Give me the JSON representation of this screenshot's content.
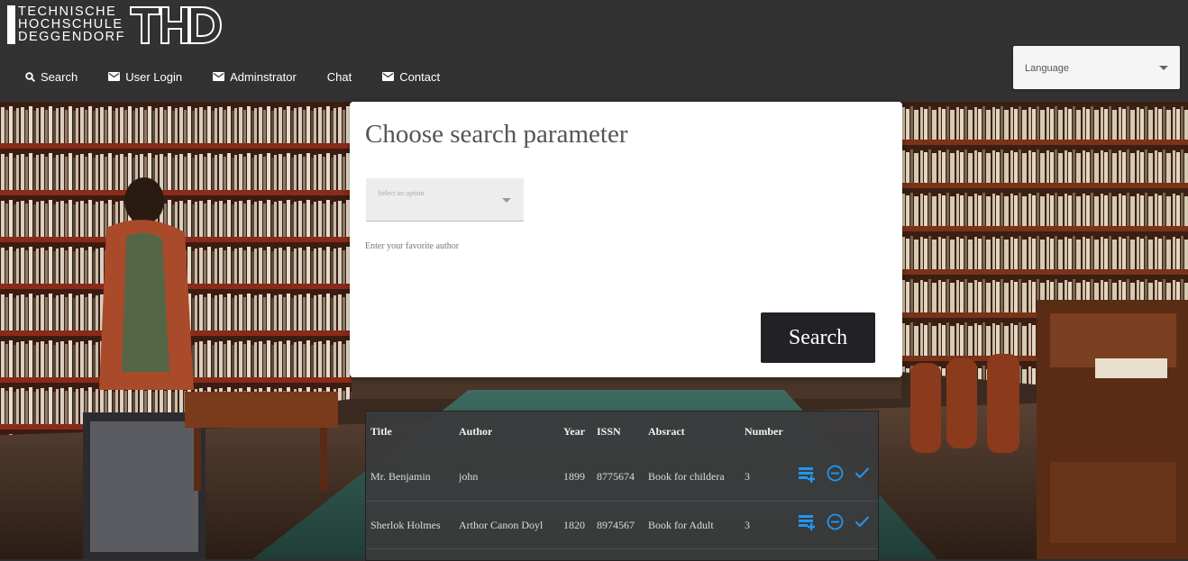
{
  "logo": {
    "line1": "TECHNISCHE",
    "line2": "HOCHSCHULE",
    "line3": "DEGGENDORF",
    "mark": "THD"
  },
  "nav": {
    "items": [
      {
        "label": "Search",
        "icon": "search-icon"
      },
      {
        "label": "User Login",
        "icon": "mail-icon"
      },
      {
        "label": "Adminstrator",
        "icon": "mail-icon"
      },
      {
        "label": "Chat",
        "icon": ""
      },
      {
        "label": "Contact",
        "icon": "mail-icon"
      }
    ]
  },
  "language": {
    "label": "Language"
  },
  "search_card": {
    "title": "Choose search parameter",
    "select_placeholder": "Select an option",
    "field_label": "Enter your favorite author",
    "button_label": "Search"
  },
  "results": {
    "headers": [
      "Title",
      "Author",
      "Year",
      "ISSN",
      "Absract",
      "Number"
    ],
    "rows": [
      {
        "title": "Mr. Benjamin",
        "author": "john",
        "year": "1899",
        "issn": "8775674",
        "abstract": "Book for childera",
        "number": "3"
      },
      {
        "title": "Sherlok Holmes",
        "author": "Arthor Canon Doyl",
        "year": "1820",
        "issn": "8974567",
        "abstract": "Book for Adult",
        "number": "3"
      }
    ],
    "action_icons": [
      "playlist-add-icon",
      "remove-circle-icon",
      "check-icon"
    ],
    "action_color": "#2196f3"
  },
  "colors": {
    "header_bg": "#323232",
    "button_bg": "#222226",
    "accent": "#2196f3"
  }
}
